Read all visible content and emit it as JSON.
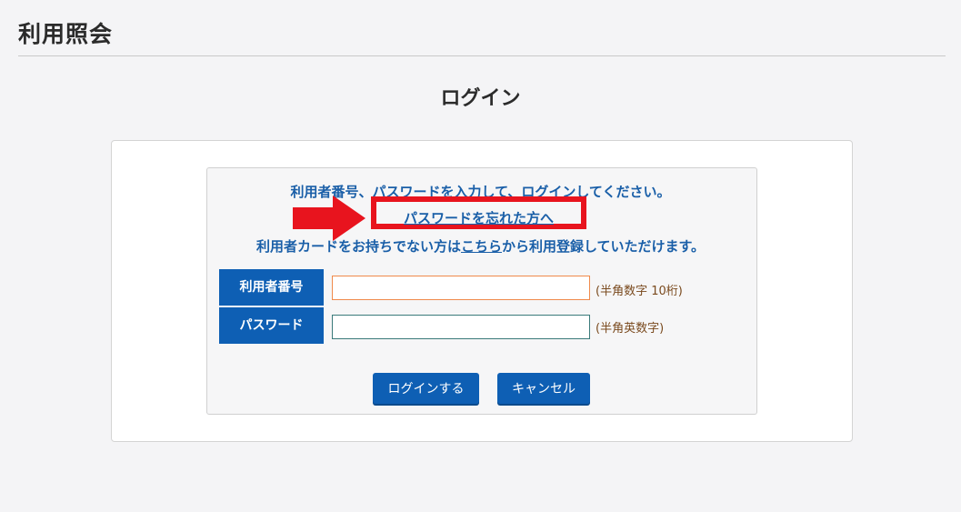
{
  "page": {
    "title": "利用照会"
  },
  "login": {
    "heading": "ログイン",
    "instruction": "利用者番号、パスワードを入力して、ログインしてください。",
    "forgot_link": "パスワードを忘れた方へ",
    "register_prefix": "利用者カードをお持ちでない方は",
    "register_link": "こちら",
    "register_suffix": "から利用登録していただけます。",
    "user_label": "利用者番号",
    "user_value": "",
    "user_hint": "(半角数字 10桁)",
    "pass_label": "パスワード",
    "pass_value": "",
    "pass_hint": "(半角英数字)",
    "login_button": "ログインする",
    "cancel_button": "キャンセル"
  },
  "colors": {
    "accent": "#0e5fb4",
    "link_text": "#1a5fa8",
    "highlight_red": "#e8141e"
  },
  "icons": {
    "annotation_arrow": "right-arrow-icon"
  }
}
